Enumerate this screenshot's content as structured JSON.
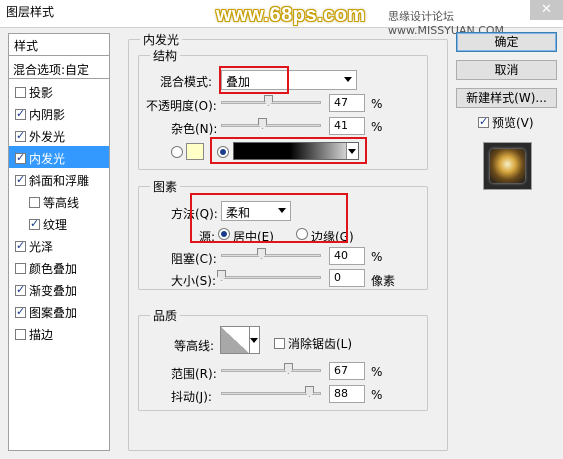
{
  "window": {
    "title": "图层样式",
    "watermark": "www.68ps.com",
    "watermark2": "思缘设计论坛 www.MISSYUAN.COM",
    "close": "✕"
  },
  "styles_panel": {
    "header": "样式",
    "blend_options": "混合选项:自定",
    "items": [
      {
        "label": "投影",
        "checked": false,
        "active": false,
        "sub": false
      },
      {
        "label": "内阴影",
        "checked": true,
        "active": false,
        "sub": false
      },
      {
        "label": "外发光",
        "checked": true,
        "active": false,
        "sub": false
      },
      {
        "label": "内发光",
        "checked": true,
        "active": true,
        "sub": false
      },
      {
        "label": "斜面和浮雕",
        "checked": true,
        "active": false,
        "sub": false
      },
      {
        "label": "等高线",
        "checked": false,
        "active": false,
        "sub": true
      },
      {
        "label": "纹理",
        "checked": true,
        "active": false,
        "sub": true
      },
      {
        "label": "光泽",
        "checked": true,
        "active": false,
        "sub": false
      },
      {
        "label": "颜色叠加",
        "checked": false,
        "active": false,
        "sub": false
      },
      {
        "label": "渐变叠加",
        "checked": true,
        "active": false,
        "sub": false
      },
      {
        "label": "图案叠加",
        "checked": true,
        "active": false,
        "sub": false
      },
      {
        "label": "描边",
        "checked": false,
        "active": false,
        "sub": false
      }
    ]
  },
  "inner_glow": {
    "title": "内发光",
    "structure": {
      "title": "结构",
      "blend_mode_label": "混合模式:",
      "blend_mode_value": "叠加",
      "opacity_label": "不透明度(O):",
      "opacity_value": "47",
      "opacity_unit": "%",
      "opacity_level": 0.47,
      "noise_label": "杂色(N):",
      "noise_value": "41",
      "noise_unit": "%",
      "noise_level": 0.41,
      "color_swatch": "#ffffc8"
    },
    "elements": {
      "title": "图素",
      "technique_label": "方法(Q):",
      "technique_value": "柔和",
      "source_label": "源:",
      "source_center": "居中(E)",
      "source_edge": "边缘(G)",
      "choke_label": "阻塞(C):",
      "choke_value": "40",
      "choke_unit": "%",
      "choke_level": 0.4,
      "size_label": "大小(S):",
      "size_value": "0",
      "size_unit": "像素",
      "size_level": 0.0
    },
    "quality": {
      "title": "品质",
      "contour_label": "等高线:",
      "antialias_label": "消除锯齿(L)",
      "range_label": "范围(R):",
      "range_value": "67",
      "range_unit": "%",
      "range_level": 0.67,
      "jitter_label": "抖动(J):",
      "jitter_value": "88",
      "jitter_unit": "%",
      "jitter_level": 0.88
    }
  },
  "buttons": {
    "ok": "确定",
    "cancel": "取消",
    "new_style": "新建样式(W)...",
    "preview": "预览(V)"
  },
  "colors": {
    "active_item": "#3399ff",
    "highlight_box": "#e0141b"
  }
}
